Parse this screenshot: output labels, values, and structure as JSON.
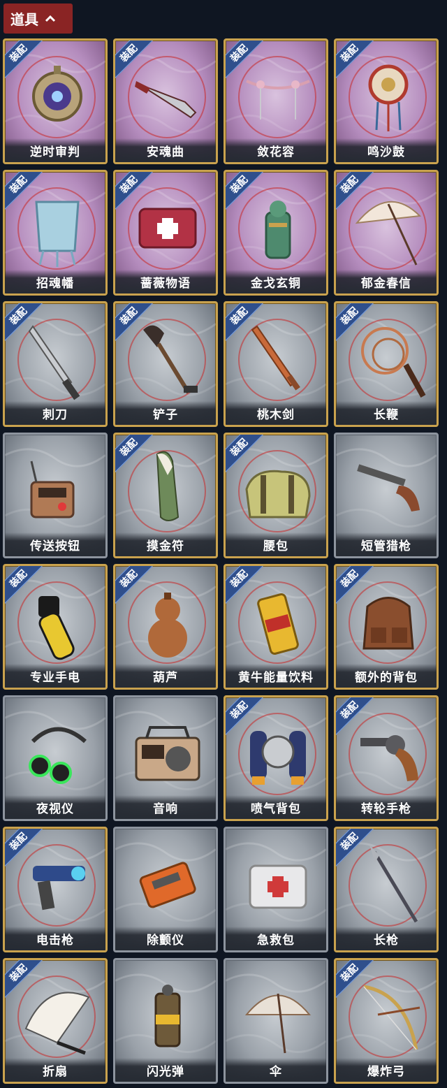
{
  "section": {
    "title": "道具"
  },
  "equip_badge": "装配",
  "items": [
    {
      "name": "逆时审判",
      "tier": "purple",
      "equipped": true,
      "icon": "pocket-watch-icon"
    },
    {
      "name": "安魂曲",
      "tier": "purple",
      "equipped": true,
      "icon": "ornate-dagger-icon"
    },
    {
      "name": "敛花容",
      "tier": "purple",
      "equipped": true,
      "icon": "flower-hairpin-icon"
    },
    {
      "name": "鸣沙鼓",
      "tier": "purple",
      "equipped": true,
      "icon": "sand-drum-icon"
    },
    {
      "name": "招魂幡",
      "tier": "purple",
      "equipped": true,
      "icon": "spirit-banner-icon"
    },
    {
      "name": "蔷薇物语",
      "tier": "purple",
      "equipped": true,
      "icon": "rose-medkit-icon"
    },
    {
      "name": "金戈玄铜",
      "tier": "purple",
      "equipped": true,
      "icon": "bronze-grenade-icon"
    },
    {
      "name": "郁金春信",
      "tier": "purple",
      "equipped": true,
      "icon": "paper-umbrella-icon"
    },
    {
      "name": "刺刀",
      "tier": "grey",
      "equipped": true,
      "icon": "bayonet-icon"
    },
    {
      "name": "铲子",
      "tier": "grey",
      "equipped": true,
      "icon": "shovel-icon"
    },
    {
      "name": "桃木剑",
      "tier": "grey",
      "equipped": true,
      "icon": "wooden-sword-icon"
    },
    {
      "name": "长鞭",
      "tier": "grey",
      "equipped": true,
      "icon": "whip-icon"
    },
    {
      "name": "传送按钮",
      "tier": "grey",
      "equipped": false,
      "icon": "teleport-button-icon"
    },
    {
      "name": "摸金符",
      "tier": "grey",
      "equipped": true,
      "icon": "talisman-icon"
    },
    {
      "name": "腰包",
      "tier": "grey",
      "equipped": true,
      "icon": "waist-bag-icon"
    },
    {
      "name": "短管猎枪",
      "tier": "grey",
      "equipped": false,
      "icon": "shotgun-icon"
    },
    {
      "name": "专业手电",
      "tier": "grey",
      "equipped": true,
      "icon": "flashlight-icon"
    },
    {
      "name": "葫芦",
      "tier": "grey",
      "equipped": true,
      "icon": "gourd-icon"
    },
    {
      "name": "黄牛能量饮料",
      "tier": "grey",
      "equipped": true,
      "icon": "energy-drink-icon"
    },
    {
      "name": "额外的背包",
      "tier": "grey",
      "equipped": true,
      "icon": "backpack-icon"
    },
    {
      "name": "夜视仪",
      "tier": "grey",
      "equipped": false,
      "icon": "night-vision-icon"
    },
    {
      "name": "音响",
      "tier": "grey",
      "equipped": false,
      "icon": "radio-speaker-icon"
    },
    {
      "name": "喷气背包",
      "tier": "grey",
      "equipped": true,
      "icon": "jetpack-icon"
    },
    {
      "name": "转轮手枪",
      "tier": "grey",
      "equipped": true,
      "icon": "revolver-icon"
    },
    {
      "name": "电击枪",
      "tier": "grey",
      "equipped": true,
      "icon": "shock-gun-icon"
    },
    {
      "name": "除颤仪",
      "tier": "grey",
      "equipped": false,
      "icon": "defibrillator-icon"
    },
    {
      "name": "急救包",
      "tier": "grey",
      "equipped": false,
      "icon": "first-aid-kit-icon"
    },
    {
      "name": "长枪",
      "tier": "grey",
      "equipped": true,
      "icon": "spear-icon"
    },
    {
      "name": "折扇",
      "tier": "grey",
      "equipped": true,
      "icon": "folding-fan-icon"
    },
    {
      "name": "闪光弹",
      "tier": "grey",
      "equipped": false,
      "icon": "flashbang-icon"
    },
    {
      "name": "伞",
      "tier": "grey",
      "equipped": false,
      "icon": "umbrella-icon"
    },
    {
      "name": "爆炸弓",
      "tier": "grey",
      "equipped": true,
      "icon": "explosive-bow-icon"
    }
  ],
  "colors": {
    "background": "#0f1622",
    "header": "#8a2424",
    "gold_frame": "#c9a24e",
    "plain_frame": "#8d949e",
    "equip_badge": "#2f4f8c"
  }
}
